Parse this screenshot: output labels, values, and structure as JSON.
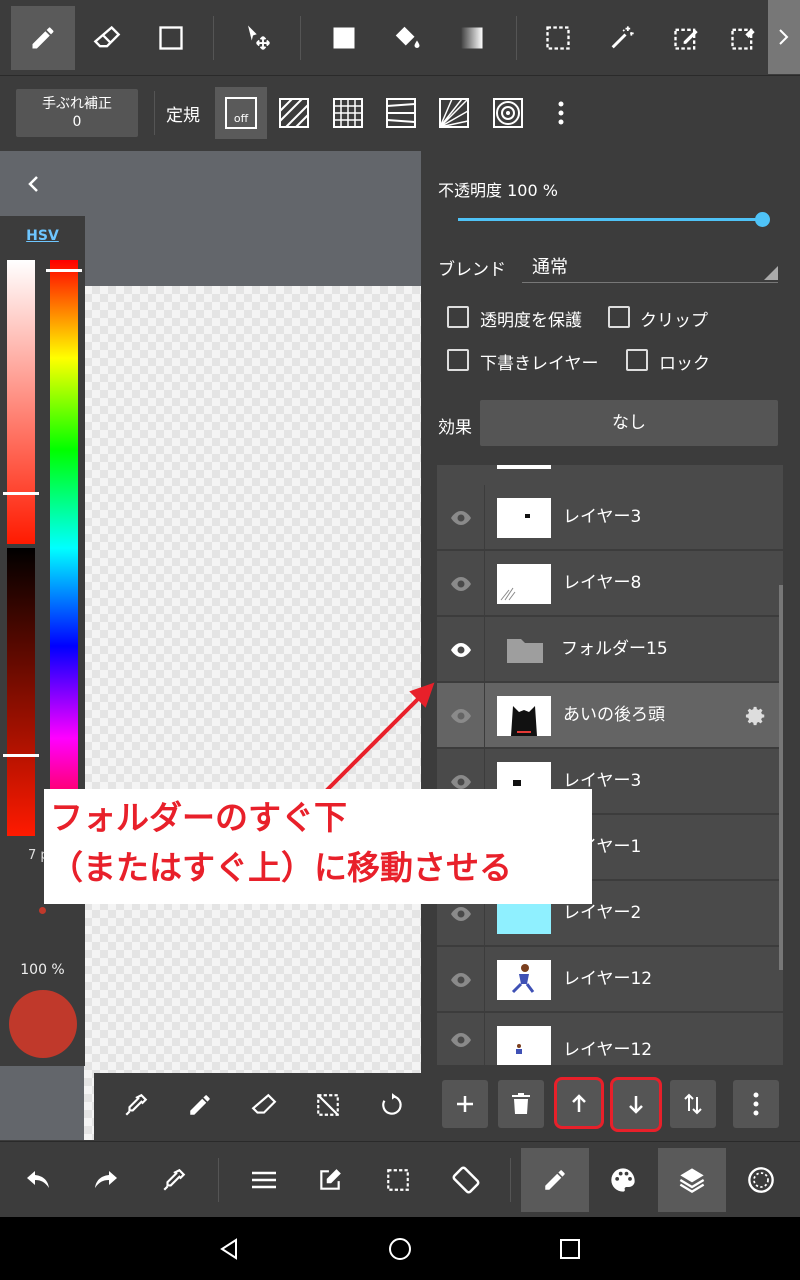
{
  "toolbar": {
    "stabilizer_label": "手ぶれ補正",
    "stabilizer_value": "0",
    "ruler_label": "定規",
    "ruler_off": "off"
  },
  "color": {
    "mode": "HSV",
    "brush_size": "7 p",
    "opacity": "100 %",
    "current": "#c0392b"
  },
  "layer_props": {
    "opacity_label": "不透明度 100 %",
    "opacity_percent": 100,
    "blend_label": "ブレンド",
    "blend_value": "通常",
    "protect_alpha": "透明度を保護",
    "clip": "クリップ",
    "draft_layer": "下書きレイヤー",
    "lock": "ロック",
    "effect_label": "効果",
    "effect_value": "なし"
  },
  "layers": [
    {
      "name": "レイヤー3",
      "visible": true
    },
    {
      "name": "レイヤー8",
      "visible": true
    },
    {
      "name": "フォルダー15",
      "visible": true,
      "folder": true
    },
    {
      "name": "あいの後ろ頭",
      "visible": true,
      "selected": true
    },
    {
      "name": "レイヤー3",
      "visible": true
    },
    {
      "name": "レイヤー1",
      "visible": true
    },
    {
      "name": "レイヤー2",
      "visible": true
    },
    {
      "name": "レイヤー12",
      "visible": true
    },
    {
      "name": "レイヤー12",
      "visible": true
    }
  ],
  "annotation": {
    "line1": "フォルダーのすぐ下",
    "line2": "（またはすぐ上）に移動させる",
    "color": "#e8202a"
  },
  "accent": "#4fc3f7"
}
